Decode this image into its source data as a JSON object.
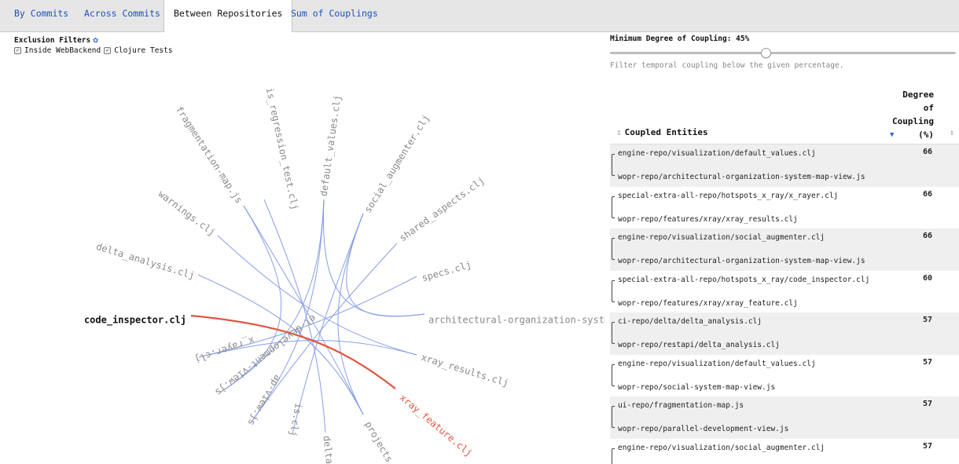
{
  "tabs": [
    {
      "label": "By Commits",
      "active": false
    },
    {
      "label": "Across Commits",
      "active": false
    },
    {
      "label": "Between Repositories",
      "active": true
    },
    {
      "label": "Sum of Couplings",
      "active": false
    }
  ],
  "filters": {
    "title": "Exclusion Filters",
    "icon": "gear-icon",
    "options": [
      {
        "label": "Inside WebBackend",
        "checked": true
      },
      {
        "label": "Clojure Tests",
        "checked": true
      }
    ]
  },
  "coupling": {
    "label": "Minimum Degree of Coupling: 45%",
    "value_percent": 45,
    "hint": "Filter temporal coupling below the given percentage."
  },
  "table": {
    "col_entities": "Coupled Entities",
    "col_degree_lines": [
      "Degree",
      "of",
      "Coupling",
      "(%)"
    ],
    "sort_glyph": "⇕",
    "rows": [
      {
        "e1": "engine-repo/visualization/default_values.clj",
        "e2": "wopr-repo/architectural-organization-system-map-view.js",
        "degree": "66"
      },
      {
        "e1": "special-extra-all-repo/hotspots_x_ray/x_rayer.clj",
        "e2": "wopr-repo/features/xray/xray_results.clj",
        "degree": "66"
      },
      {
        "e1": "engine-repo/visualization/social_augmenter.clj",
        "e2": "wopr-repo/architectural-organization-system-map-view.js",
        "degree": "66"
      },
      {
        "e1": "special-extra-all-repo/hotspots_x_ray/code_inspector.clj",
        "e2": "wopr-repo/features/xray/xray_feature.clj",
        "degree": "60"
      },
      {
        "e1": "ci-repo/delta/delta_analysis.clj",
        "e2": "wopr-repo/restapi/delta_analysis.clj",
        "degree": "57"
      },
      {
        "e1": "engine-repo/visualization/default_values.clj",
        "e2": "wopr-repo/social-system-map-view.js",
        "degree": "57"
      },
      {
        "e1": "ui-repo/fragmentation-map.js",
        "e2": "wopr-repo/parallel-development-view.js",
        "degree": "57"
      },
      {
        "e1": "engine-repo/visualization/social_augmenter.clj",
        "e2": "",
        "degree": "57"
      }
    ]
  },
  "graph": {
    "nodes": [
      {
        "id": "is_regression_test",
        "label": "is_regression_test.clj"
      },
      {
        "id": "default_values",
        "label": "default_values.clj"
      },
      {
        "id": "social_augmenter",
        "label": "social_augmenter.clj"
      },
      {
        "id": "shared_aspects",
        "label": "shared_aspects.clj"
      },
      {
        "id": "specs",
        "label": "specs.clj"
      },
      {
        "id": "arch_map",
        "label": "architectural-organization-system-ma"
      },
      {
        "id": "xray_results",
        "label": "xray_results.clj"
      },
      {
        "id": "xray_feature",
        "label": "xray_feature.clj"
      },
      {
        "id": "projects",
        "label": "projects.s"
      },
      {
        "id": "delta",
        "label": "delta."
      },
      {
        "id": "is_clj",
        "label": "is.clj"
      },
      {
        "id": "map_view",
        "label": "ap-view.js"
      },
      {
        "id": "parallel_dev",
        "label": "el-development-view.js"
      },
      {
        "id": "x_rayer",
        "label": "x_rayer.clj"
      },
      {
        "id": "code_inspector",
        "label": "code_inspector.clj"
      },
      {
        "id": "delta_analysis",
        "label": "delta_analysis.clj"
      },
      {
        "id": "warnings",
        "label": "warnings.clj"
      },
      {
        "id": "fragmentation_map",
        "label": "fragmentation-map.js"
      }
    ],
    "focus_node": "code_inspector",
    "highlight_node": "xray_feature",
    "link_color": "#7b93e6",
    "highlight_color": "#e2543f"
  }
}
